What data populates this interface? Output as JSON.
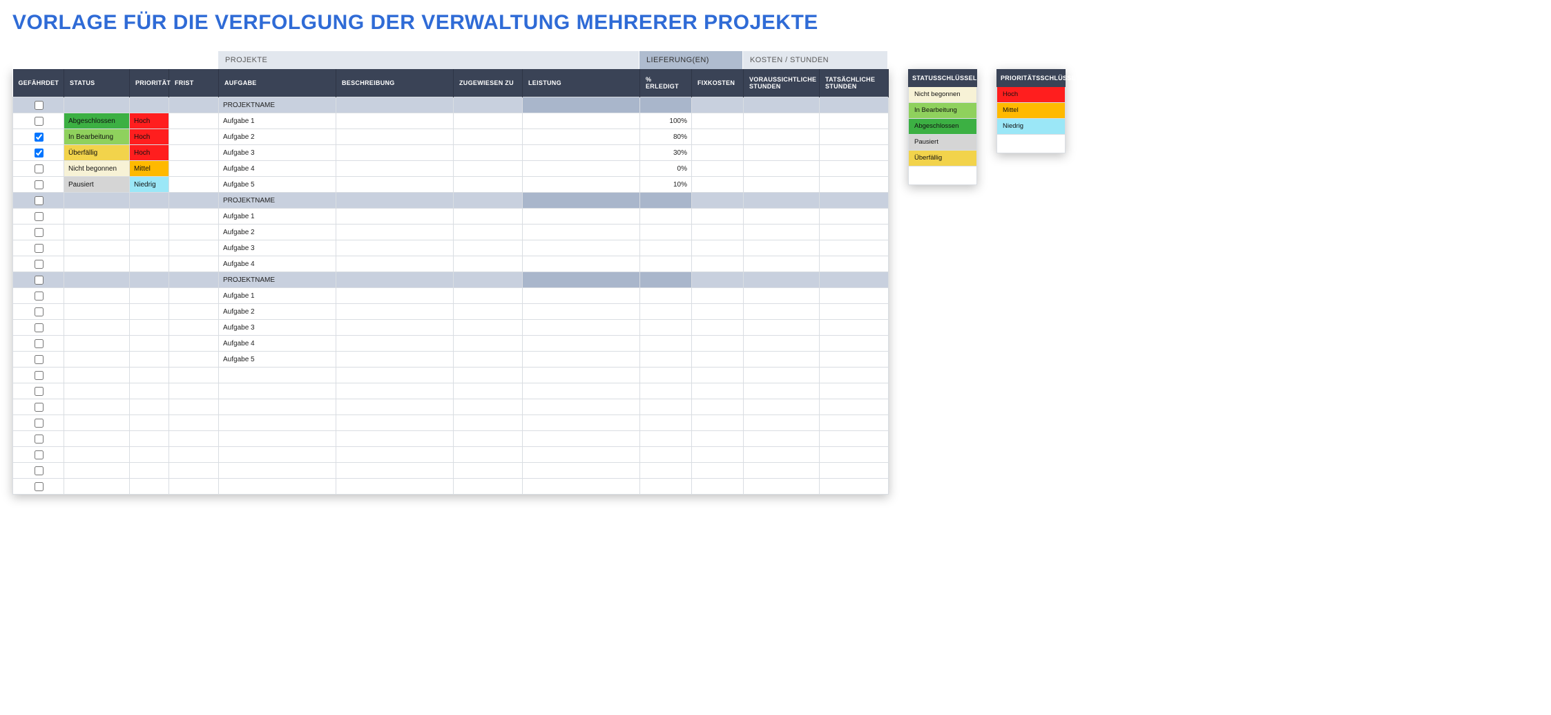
{
  "title": "VORLAGE FÜR DIE VERFOLGUNG DER VERWALTUNG MEHRERER PROJEKTE",
  "groups": {
    "projects": "PROJEKTE",
    "delivery": "LIEFERUNG(EN)",
    "costs": "KOSTEN / STUNDEN"
  },
  "columns": {
    "risk": "GEFÄHRDET",
    "status": "STATUS",
    "prio": "PRIORITÄT",
    "frist": "FRIST",
    "task": "AUFGABE",
    "desc": "BESCHREIBUNG",
    "assn": "ZUGEWIESEN ZU",
    "perf": "LEISTUNG",
    "done": "% ERLEDIGT",
    "fix": "FIXKOSTEN",
    "est": "VORAUSSICHTLICHE STUNDEN",
    "act": "TATSÄCHLICHE STUNDEN"
  },
  "rows": [
    {
      "type": "project",
      "checked": false,
      "task": "PROJEKTNAME"
    },
    {
      "type": "task",
      "checked": false,
      "status": "Abgeschlossen",
      "status_cls": "st-abgeschlossen",
      "prio": "Hoch",
      "prio_cls": "pr-hoch",
      "task": "Aufgabe 1",
      "done": "100%"
    },
    {
      "type": "task",
      "checked": true,
      "status": "In Bearbeitung",
      "status_cls": "st-inbearbeitung",
      "prio": "Hoch",
      "prio_cls": "pr-hoch",
      "task": "Aufgabe 2",
      "done": "80%"
    },
    {
      "type": "task",
      "checked": true,
      "status": "Überfällig",
      "status_cls": "st-ueberfaellig",
      "prio": "Hoch",
      "prio_cls": "pr-hoch",
      "task": "Aufgabe 3",
      "done": "30%"
    },
    {
      "type": "task",
      "checked": false,
      "status": "Nicht begonnen",
      "status_cls": "st-nichtbegonnen",
      "prio": "Mittel",
      "prio_cls": "pr-mittel",
      "task": "Aufgabe 4",
      "done": "0%"
    },
    {
      "type": "task",
      "checked": false,
      "status": "Pausiert",
      "status_cls": "st-pausiert",
      "prio": "Niedrig",
      "prio_cls": "pr-niedrig",
      "task": "Aufgabe 5",
      "done": "10%"
    },
    {
      "type": "project",
      "checked": false,
      "task": "PROJEKTNAME"
    },
    {
      "type": "task",
      "checked": false,
      "task": "Aufgabe 1"
    },
    {
      "type": "task",
      "checked": false,
      "task": "Aufgabe 2"
    },
    {
      "type": "task",
      "checked": false,
      "task": "Aufgabe 3"
    },
    {
      "type": "task",
      "checked": false,
      "task": "Aufgabe 4"
    },
    {
      "type": "project",
      "checked": false,
      "task": "PROJEKTNAME"
    },
    {
      "type": "task",
      "checked": false,
      "task": "Aufgabe 1"
    },
    {
      "type": "task",
      "checked": false,
      "task": "Aufgabe 2"
    },
    {
      "type": "task",
      "checked": false,
      "task": "Aufgabe 3"
    },
    {
      "type": "task",
      "checked": false,
      "task": "Aufgabe 4"
    },
    {
      "type": "task",
      "checked": false,
      "task": "Aufgabe 5"
    },
    {
      "type": "empty",
      "checked": false
    },
    {
      "type": "empty",
      "checked": false
    },
    {
      "type": "empty",
      "checked": false
    },
    {
      "type": "empty",
      "checked": false
    },
    {
      "type": "empty",
      "checked": false
    },
    {
      "type": "empty",
      "checked": false
    },
    {
      "type": "empty",
      "checked": false
    },
    {
      "type": "empty",
      "checked": false
    }
  ],
  "status_key": {
    "header": "STATUSSCHLÜSSEL",
    "items": [
      {
        "label": "Nicht begonnen",
        "cls": "st-nichtbegonnen"
      },
      {
        "label": "In Bearbeitung",
        "cls": "st-inbearbeitung"
      },
      {
        "label": "Abgeschlossen",
        "cls": "st-abgeschlossen"
      },
      {
        "label": "Pausiert",
        "cls": "st-pausiert"
      },
      {
        "label": "Überfällig",
        "cls": "st-ueberfaellig"
      }
    ]
  },
  "priority_key": {
    "header": "PRIORITÄTSSCHLÜSSEL",
    "items": [
      {
        "label": "Hoch",
        "cls": "pr-hoch"
      },
      {
        "label": "Mittel",
        "cls": "pr-mittel"
      },
      {
        "label": "Niedrig",
        "cls": "pr-niedrig"
      }
    ]
  }
}
